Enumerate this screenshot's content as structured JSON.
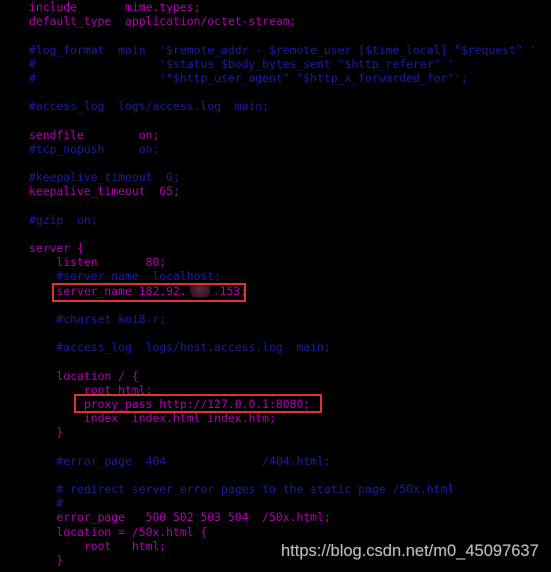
{
  "terminal": {
    "colors": {
      "background": "#000000",
      "directive": "#b400b4",
      "comment": "#1c1ca8",
      "highlight_box": "#e0322e"
    },
    "lines": [
      {
        "text": "include       mime.types;",
        "type": "code"
      },
      {
        "text": "default_type  application/octet-stream;",
        "type": "code"
      },
      {
        "text": "",
        "type": "code"
      },
      {
        "text": "#log_format  main  '$remote_addr - $remote_user [$time_local] \"$request\" '",
        "type": "comment"
      },
      {
        "text": "#                  '$status $body_bytes_sent \"$http_referer\" '",
        "type": "comment"
      },
      {
        "text": "#                  '\"$http_user_agent\" \"$http_x_forwarded_for\"';",
        "type": "comment"
      },
      {
        "text": "",
        "type": "code"
      },
      {
        "text": "#access_log  logs/access.log  main;",
        "type": "comment"
      },
      {
        "text": "",
        "type": "code"
      },
      {
        "text": "sendfile        on;",
        "type": "code"
      },
      {
        "text": "#tcp_nopush     on;",
        "type": "comment"
      },
      {
        "text": "",
        "type": "code"
      },
      {
        "text": "#keepalive_timeout  0;",
        "type": "comment"
      },
      {
        "text": "keepalive_timeout  65;",
        "type": "code"
      },
      {
        "text": "",
        "type": "code"
      },
      {
        "text": "#gzip  on;",
        "type": "comment"
      },
      {
        "text": "",
        "type": "code"
      },
      {
        "text": "server {",
        "type": "code"
      },
      {
        "text": "    listen       80;",
        "type": "code"
      },
      {
        "text": "    #server_name  localhost;",
        "type": "comment"
      },
      {
        "text": "    server_name 182.92.",
        "suffix": ".153;",
        "redacted": true,
        "type": "code"
      },
      {
        "text": "",
        "type": "code"
      },
      {
        "text": "    #charset koi8-r;",
        "type": "comment"
      },
      {
        "text": "",
        "type": "code"
      },
      {
        "text": "    #access_log  logs/host.access.log  main;",
        "type": "comment"
      },
      {
        "text": "",
        "type": "code"
      },
      {
        "text": "    location / {",
        "type": "code"
      },
      {
        "text": "        root html;",
        "type": "code"
      },
      {
        "text": "        proxy_pass http://127.0.0.1:8080;",
        "type": "code"
      },
      {
        "text": "        index  index.html index.htm;",
        "type": "code"
      },
      {
        "text": "    }",
        "type": "code"
      },
      {
        "text": "",
        "type": "code"
      },
      {
        "text": "    #error_page  404              /404.html;",
        "type": "comment"
      },
      {
        "text": "",
        "type": "code"
      },
      {
        "text": "    # redirect server error pages to the static page /50x.html",
        "type": "comment"
      },
      {
        "text": "    #",
        "type": "comment"
      },
      {
        "text": "    error_page   500 502 503 504  /50x.html;",
        "type": "code"
      },
      {
        "text": "    location = /50x.html {",
        "type": "code"
      },
      {
        "text": "        root   html;",
        "type": "code"
      },
      {
        "text": "    }",
        "type": "code"
      }
    ]
  },
  "watermark": "https://blog.csdn.net/m0_45097637"
}
